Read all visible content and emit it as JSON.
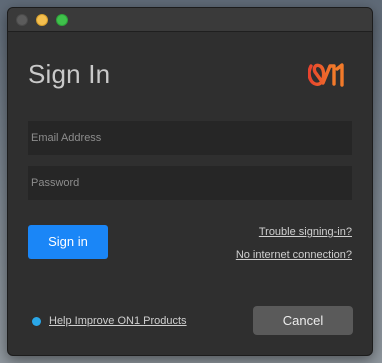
{
  "window": {
    "title_bar_buttons": [
      "close",
      "minimize",
      "maximize"
    ]
  },
  "dialog": {
    "title": "Sign In",
    "logo_icon": "on1-logo-icon",
    "logo_colors": [
      "#e8432e",
      "#f27a2a"
    ]
  },
  "form": {
    "email_placeholder": "Email Address",
    "email_value": "",
    "password_placeholder": "Password",
    "password_value": ""
  },
  "actions": {
    "signin_label": "Sign in",
    "trouble_link": "Trouble signing-in?",
    "no_internet_link": "No internet connection?",
    "help_label": "Help Improve ON1 Products",
    "cancel_label": "Cancel"
  },
  "colors": {
    "accent": "#1a86f7",
    "help_dot": "#2aa7e8",
    "window_bg": "#2f2f2f"
  }
}
